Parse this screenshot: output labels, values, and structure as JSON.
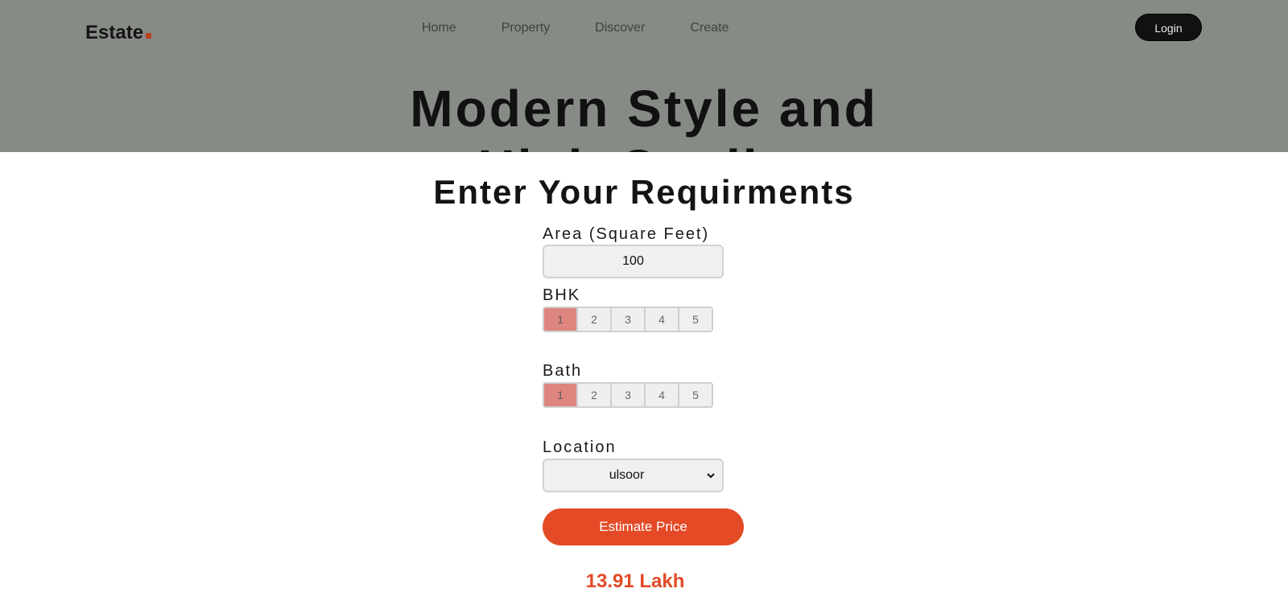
{
  "brand": {
    "name": "Estate",
    "dot_color": "#b8401c"
  },
  "nav": [
    "Home",
    "Property",
    "Discover",
    "Create"
  ],
  "header": {
    "login_label": "Login"
  },
  "hero": {
    "title_line1": "Modern Style and",
    "title_line2": "High Quality"
  },
  "form": {
    "title": "Enter Your Requirments",
    "area": {
      "label": "Area (Square Feet)",
      "value": "100"
    },
    "bhk": {
      "label": "BHK",
      "options": [
        "1",
        "2",
        "3",
        "4",
        "5"
      ],
      "selected": "1"
    },
    "bath": {
      "label": "Bath",
      "options": [
        "1",
        "2",
        "3",
        "4",
        "5"
      ],
      "selected": "1"
    },
    "location": {
      "label": "Location",
      "value": "ulsoor"
    },
    "submit_label": "Estimate Price"
  },
  "result": {
    "price": "13.91 Lakh"
  },
  "colors": {
    "accent": "#e44a26",
    "selected_option": "#de857f",
    "overlay": "#878b86"
  }
}
